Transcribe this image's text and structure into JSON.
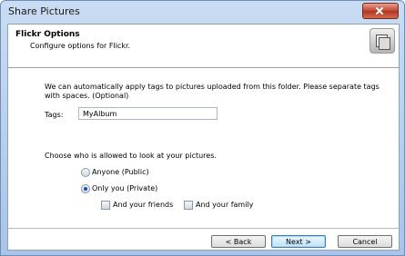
{
  "window": {
    "title": "Share Pictures"
  },
  "header": {
    "title": "Flickr Options",
    "subtitle": "Configure options for Flickr.",
    "icon": "pictures-icon"
  },
  "body": {
    "description": "We can automatically apply tags to pictures uploaded from this folder. Please separate tags with spaces. (Optional)"
  },
  "tags": {
    "label": "Tags:",
    "value": "MyAlbum"
  },
  "visibility": {
    "prompt": "Choose who is allowed to look at your pictures.",
    "options": [
      {
        "label": "Anyone (Public)",
        "selected": false
      },
      {
        "label": "Only you (Private)",
        "selected": true
      }
    ],
    "checkboxes": [
      {
        "label": "And your friends",
        "checked": false
      },
      {
        "label": "And your family",
        "checked": false
      }
    ]
  },
  "buttons": {
    "back": "< Back",
    "next": "Next >",
    "cancel": "Cancel"
  },
  "colors": {
    "titlebar": "#b9d1ea",
    "accent": "#1c4fb4",
    "close": "#c0462f"
  }
}
